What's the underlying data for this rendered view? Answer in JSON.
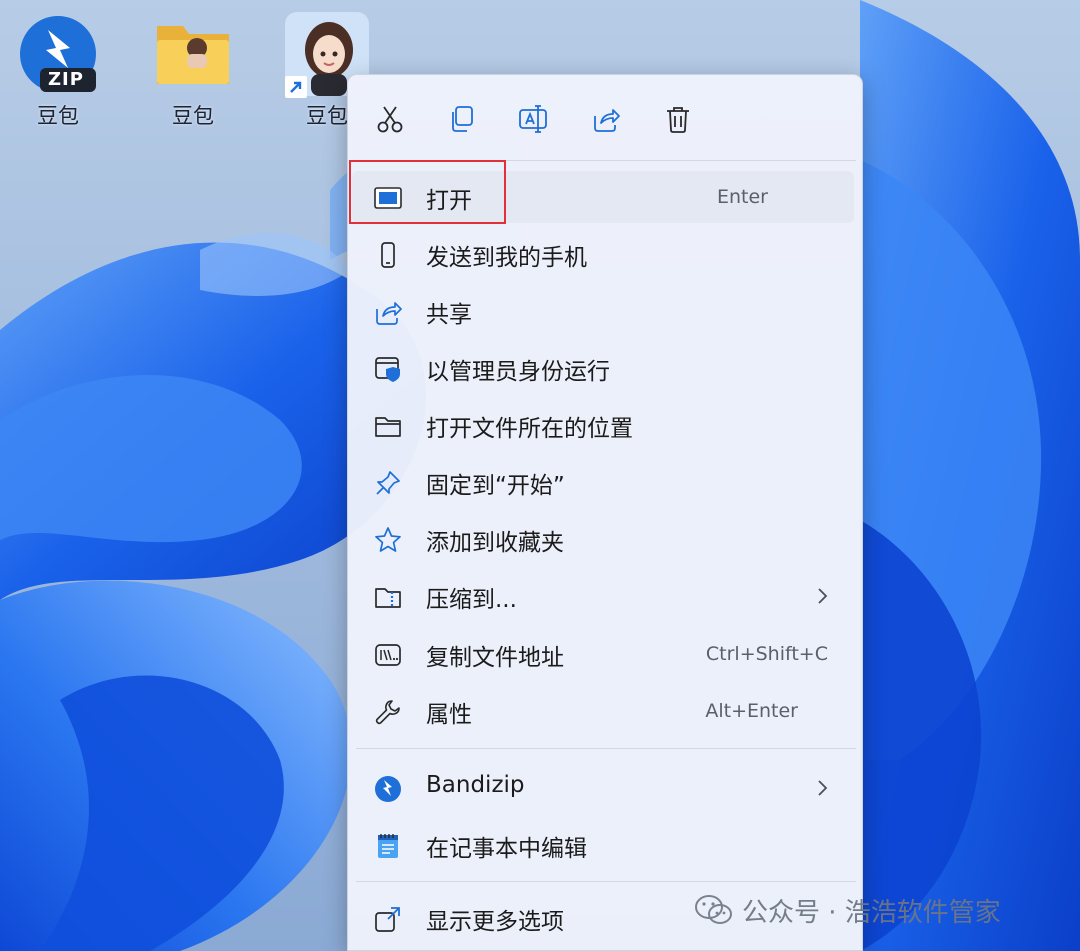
{
  "desktop": {
    "icons": [
      {
        "label": "豆包",
        "badge": "ZIP"
      },
      {
        "label": "豆包"
      },
      {
        "label": "豆包"
      }
    ]
  },
  "toolbar": {
    "buttons": [
      "cut-icon",
      "copy-icon",
      "rename-icon",
      "share-icon",
      "delete-icon"
    ]
  },
  "menu": {
    "items": [
      {
        "label": "打开",
        "shortcut": "Enter",
        "icon": "open-window-icon"
      },
      {
        "label": "发送到我的手机",
        "icon": "phone-icon"
      },
      {
        "label": "共享",
        "icon": "share-icon"
      },
      {
        "label": "以管理员身份运行",
        "icon": "admin-shield-icon"
      },
      {
        "label": "打开文件所在的位置",
        "icon": "folder-icon"
      },
      {
        "label": "固定到“开始”",
        "icon": "pin-icon"
      },
      {
        "label": "添加到收藏夹",
        "icon": "star-icon"
      },
      {
        "label": "压缩到...",
        "icon": "zip-folder-icon",
        "submenu": true
      },
      {
        "label": "复制文件地址",
        "shortcut": "Ctrl+Shift+C",
        "icon": "path-icon"
      },
      {
        "label": "属性",
        "shortcut": "Alt+Enter",
        "icon": "wrench-icon"
      },
      {
        "label": "Bandizip",
        "icon": "bandizip-icon",
        "submenu": true
      },
      {
        "label": "在记事本中编辑",
        "icon": "notepad-icon"
      },
      {
        "label": "显示更多选项",
        "icon": "more-options-icon"
      }
    ]
  },
  "watermark": {
    "text": "公众号 · 浩浩软件管家"
  },
  "colors": {
    "accent": "#1f6fd8",
    "highlight_border": "#e0303a"
  }
}
